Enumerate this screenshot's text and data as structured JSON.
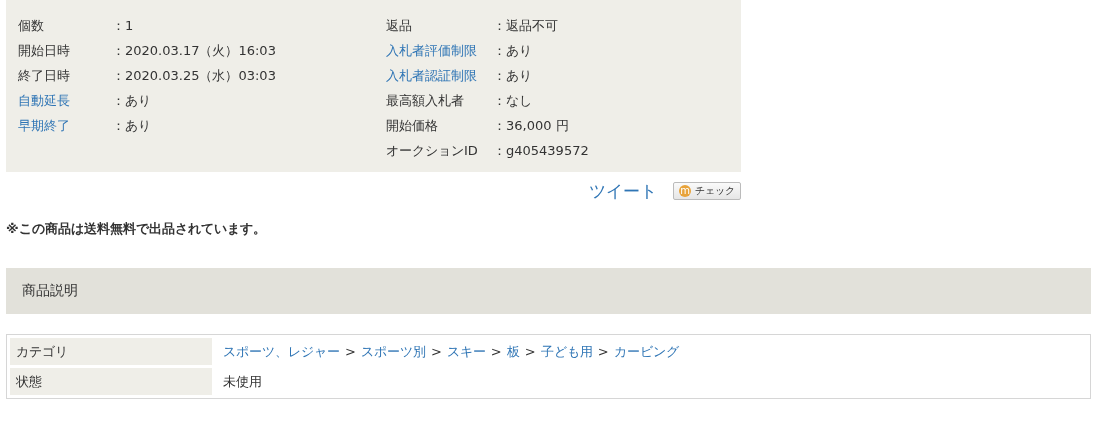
{
  "info": {
    "left": [
      {
        "label": "個数",
        "value": "：1",
        "link": false
      },
      {
        "label": "開始日時",
        "value": "：2020.03.17（火）16:03",
        "link": false
      },
      {
        "label": "終了日時",
        "value": "：2020.03.25（水）03:03",
        "link": false
      },
      {
        "label": "自動延長",
        "value": "：あり",
        "link": true
      },
      {
        "label": "早期終了",
        "value": "：あり",
        "link": true
      }
    ],
    "right": [
      {
        "label": "返品",
        "value": "：返品不可",
        "link": false
      },
      {
        "label": "入札者評価制限",
        "value": "：あり",
        "link": true
      },
      {
        "label": "入札者認証制限",
        "value": "：あり",
        "link": true
      },
      {
        "label": "最高額入札者",
        "value": "：なし",
        "link": false
      },
      {
        "label": "開始価格",
        "value": "：36,000 円",
        "link": false
      },
      {
        "label": "オークションID",
        "value": "：g405439572",
        "link": false
      }
    ]
  },
  "share": {
    "tweet": "ツイート",
    "check_icon": "m",
    "check": "チェック"
  },
  "notice": "※この商品は送料無料で出品されています。",
  "section_title": "商品説明",
  "details": [
    {
      "label": "カテゴリ",
      "kind": "breadcrumb",
      "separator": ">",
      "items": [
        "スポーツ、レジャー",
        "スポーツ別",
        "スキー",
        "板",
        "子ども用",
        "カービング"
      ]
    },
    {
      "label": "状態",
      "kind": "text",
      "value": "未使用"
    }
  ]
}
